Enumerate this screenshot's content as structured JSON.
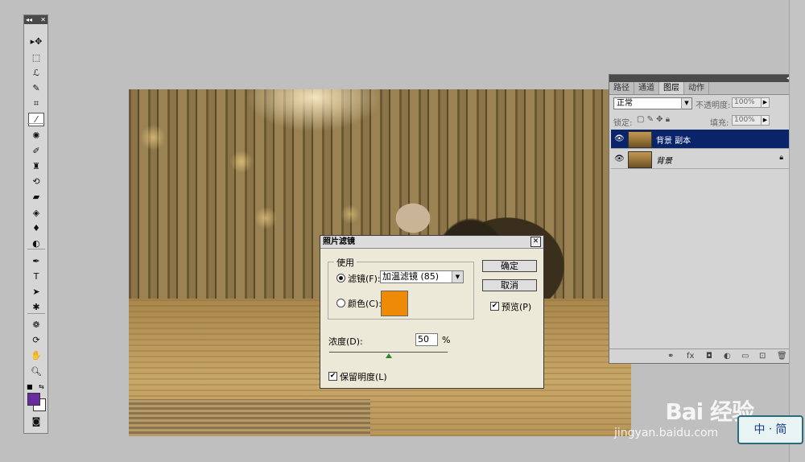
{
  "toolbox": {
    "header_left": "◂◂",
    "header_right": "✕",
    "tools": [
      {
        "name": "move-tool-icon",
        "glyph": "▸✥"
      },
      {
        "name": "marquee-tool-icon",
        "glyph": "⬚"
      },
      {
        "name": "lasso-tool-icon",
        "glyph": "ℒ"
      },
      {
        "name": "quick-select-tool-icon",
        "glyph": "✎"
      },
      {
        "name": "crop-tool-icon",
        "glyph": "⌗"
      },
      {
        "name": "eyedropper-tool-icon",
        "glyph": "⁄"
      },
      {
        "name": "healing-tool-icon",
        "glyph": "✺"
      },
      {
        "name": "brush-tool-icon",
        "glyph": "✐"
      },
      {
        "name": "stamp-tool-icon",
        "glyph": "♜"
      },
      {
        "name": "history-brush-tool-icon",
        "glyph": "⟲"
      },
      {
        "name": "eraser-tool-icon",
        "glyph": "▰"
      },
      {
        "name": "bucket-tool-icon",
        "glyph": "◈"
      },
      {
        "name": "blur-tool-icon",
        "glyph": "♦"
      },
      {
        "name": "dodge-tool-icon",
        "glyph": "◐"
      },
      {
        "name": "pen-tool-icon",
        "glyph": "✒"
      },
      {
        "name": "type-tool-icon",
        "glyph": "T"
      },
      {
        "name": "path-select-tool-icon",
        "glyph": "➤"
      },
      {
        "name": "shape-tool-icon",
        "glyph": "✱"
      },
      {
        "name": "3d-rotate-tool-icon",
        "glyph": "❁"
      },
      {
        "name": "3d-orbit-tool-icon",
        "glyph": "⟳"
      },
      {
        "name": "hand-tool-icon",
        "glyph": "✋"
      },
      {
        "name": "zoom-tool-icon",
        "glyph": "🔍︎"
      }
    ],
    "colors": {
      "foreground": "#6b2ba0",
      "background": "#ffffff"
    }
  },
  "dialog": {
    "title": "照片滤镜",
    "close": "✕",
    "group_label": "使用",
    "filter_label": "滤镜(F):",
    "filter_value": "加温滤镜 (85)",
    "color_label": "颜色(C):",
    "color_value": "#ef8a07",
    "density_label": "浓度(D):",
    "density_value": "50",
    "density_unit": "%",
    "density_level": 0.5,
    "preserve_label": "保留明度(L)",
    "preserve_checked": true,
    "ok": "确定",
    "cancel": "取消",
    "preview_label": "预览(P)",
    "preview_checked": true,
    "selected_option": "filter"
  },
  "layers_panel": {
    "tabs": [
      "路径",
      "通道",
      "图层",
      "动作"
    ],
    "active_tab": "图层",
    "blend_mode": "正常",
    "opacity_label": "不透明度:",
    "opacity_value": "100%",
    "lock_label": "锁定:",
    "fill_label": "填充:",
    "fill_value": "100%",
    "layers": [
      {
        "name": "背景 副本",
        "selected": true,
        "locked": false
      },
      {
        "name": "背景",
        "selected": false,
        "locked": true
      }
    ]
  },
  "watermark": {
    "brand": "Bai 经验",
    "url": "jingyan.baidu.com",
    "stamp": "中ㆍ简"
  }
}
